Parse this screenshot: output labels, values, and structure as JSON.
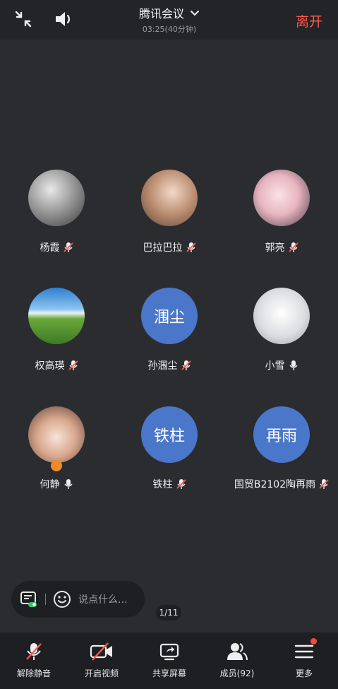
{
  "header": {
    "title": "腾讯会议",
    "timer": "03:25(40分钟)",
    "leave_label": "离开"
  },
  "participants": [
    {
      "name": "杨霞",
      "mic": "muted",
      "avatar": "photo"
    },
    {
      "name": "巴拉巴拉",
      "mic": "muted",
      "avatar": "photo"
    },
    {
      "name": "郭亮",
      "mic": "muted",
      "avatar": "photo"
    },
    {
      "name": "权高瑛",
      "mic": "muted",
      "avatar": "photo"
    },
    {
      "name": "孙涠尘",
      "mic": "muted",
      "avatar": "initials",
      "initials": "涠尘"
    },
    {
      "name": "小雪",
      "mic": "on",
      "avatar": "photo"
    },
    {
      "name": "何静",
      "mic": "on",
      "avatar": "photo",
      "host": true
    },
    {
      "name": "铁柱",
      "mic": "muted",
      "avatar": "initials",
      "initials": "铁柱"
    },
    {
      "name": "国贸B2102陶再雨",
      "mic": "muted",
      "avatar": "initials",
      "initials": "再雨"
    }
  ],
  "chat": {
    "placeholder": "说点什么..."
  },
  "pager": "1/11",
  "toolbar": {
    "unmute_label": "解除静音",
    "video_label": "开启视频",
    "share_label": "共享屏幕",
    "members_label": "成员(92)",
    "more_label": "更多"
  },
  "colors": {
    "leave": "#ff5a4e",
    "initials_bg": "#4a77c9",
    "notify_dot": "#f04c3c"
  },
  "icons": {
    "top_left": "minimize-arrows-icon",
    "speaker": "speaker-icon",
    "chevron": "chevron-down-icon"
  }
}
